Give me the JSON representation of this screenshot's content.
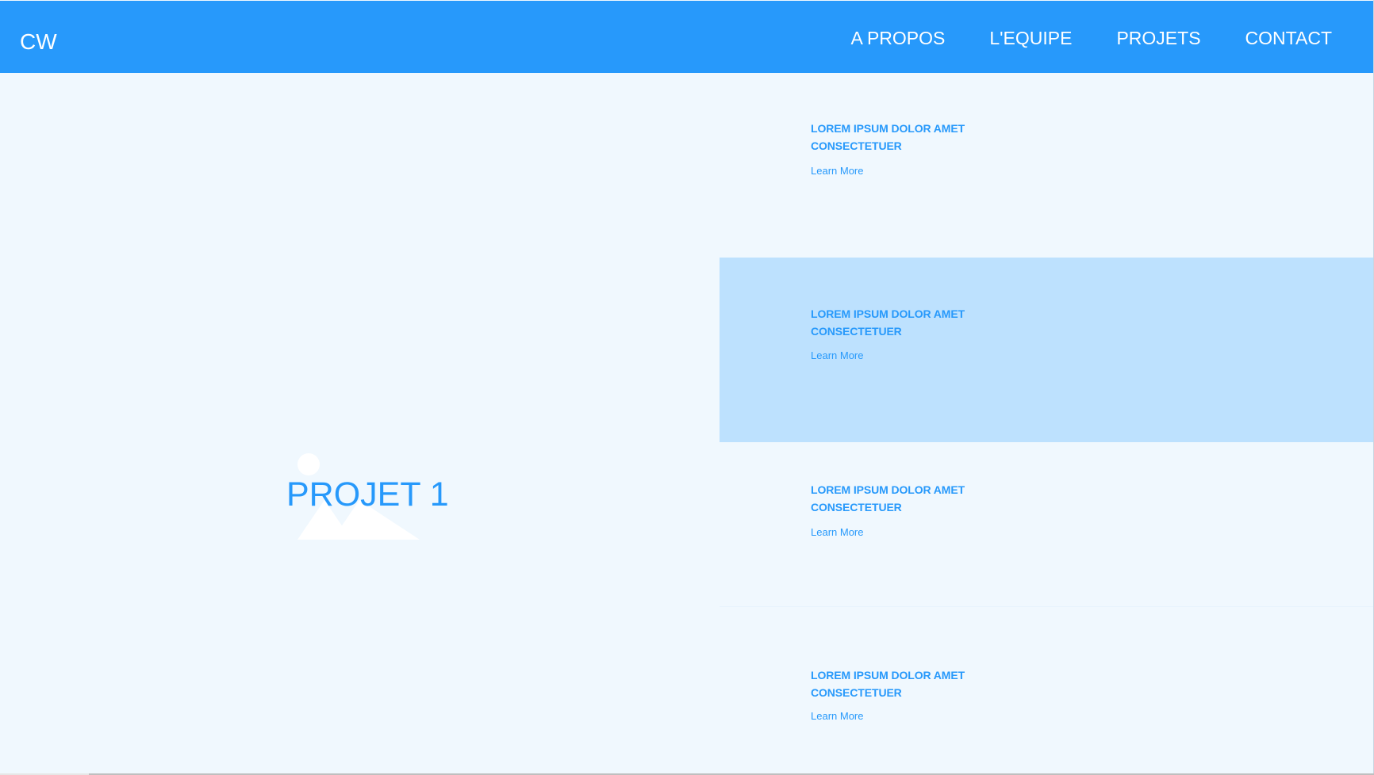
{
  "header": {
    "logo": "CW",
    "nav": [
      {
        "label": "A PROPOS"
      },
      {
        "label": "L'EQUIPE"
      },
      {
        "label": "PROJETS"
      },
      {
        "label": "CONTACT"
      }
    ]
  },
  "hero": {
    "title": "PROJET 1",
    "image_icon": "image-placeholder-icon"
  },
  "list": [
    {
      "title": "LOREM IPSUM DOLOR AMET CONSECTETUER",
      "link": "Learn More",
      "active": false
    },
    {
      "title": "LOREM IPSUM DOLOR AMET CONSECTETUER",
      "link": "Learn More",
      "active": true
    },
    {
      "title": "LOREM IPSUM DOLOR AMET CONSECTETUER",
      "link": "Learn More",
      "active": false
    },
    {
      "title": "LOREM IPSUM DOLOR AMET CONSECTETUER",
      "link": "Learn More",
      "active": false
    }
  ],
  "colors": {
    "header_bg": "#2799fb",
    "page_bg": "#f0f8fe",
    "active_item_bg": "#bde1fe",
    "accent_text": "#2799fb",
    "header_text": "#ffffff"
  }
}
